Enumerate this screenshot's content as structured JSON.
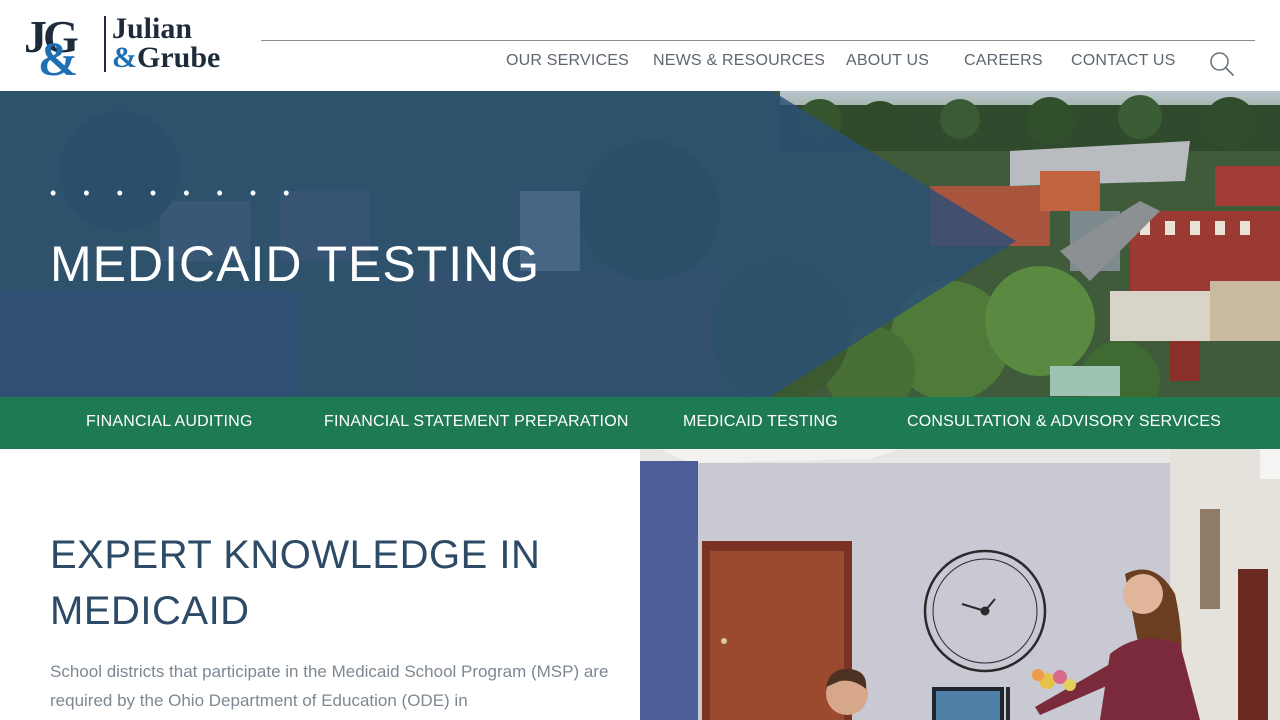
{
  "logo": {
    "mark": "JG",
    "amp": "&",
    "name_line1": "Julian",
    "name_amp": "&",
    "name_line2": "Grube"
  },
  "nav": {
    "items": [
      {
        "label": "OUR SERVICES"
      },
      {
        "label": "NEWS & RESOURCES"
      },
      {
        "label": "ABOUT US"
      },
      {
        "label": "CAREERS"
      },
      {
        "label": "CONTACT US"
      }
    ],
    "search_icon": "search-icon"
  },
  "hero": {
    "dots": "• • • • • • • •",
    "title": "MEDICAID TESTING"
  },
  "services": {
    "items": [
      {
        "label": "FINANCIAL AUDITING"
      },
      {
        "label": "FINANCIAL STATEMENT PREPARATION"
      },
      {
        "label": "MEDICAID TESTING"
      },
      {
        "label": "CONSULTATION & ADVISORY SERVICES"
      }
    ]
  },
  "content": {
    "title": "EXPERT KNOWLEDGE IN MEDICAID",
    "body": "School districts that participate in the Medicaid School Program (MSP) are required by the Ohio Department of Education (ODE) in"
  },
  "colors": {
    "brand_navy": "#2d4a66",
    "brand_green": "#1e7a52",
    "brand_blue": "#1f6fb5",
    "overlay_blue": "#2b4f78",
    "nav_text": "#5d6670"
  }
}
